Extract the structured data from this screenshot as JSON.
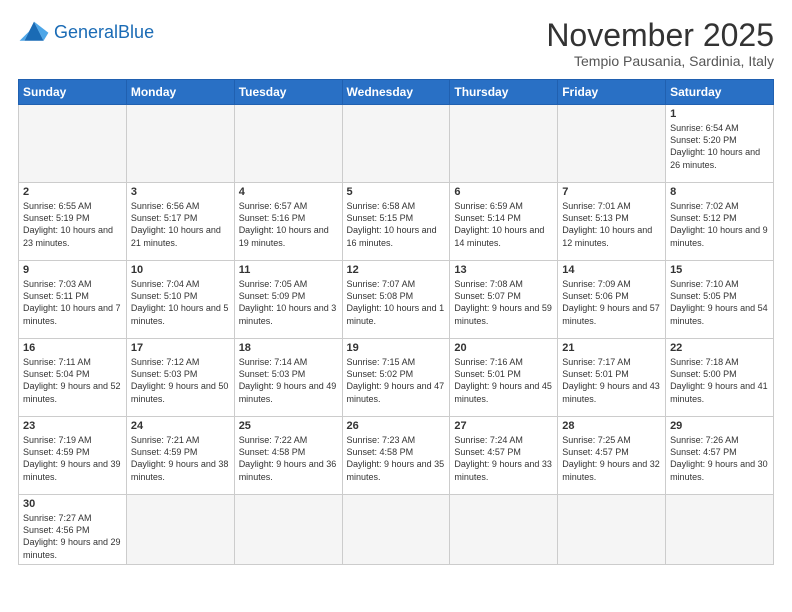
{
  "header": {
    "logo_general": "General",
    "logo_blue": "Blue",
    "month": "November 2025",
    "location": "Tempio Pausania, Sardinia, Italy"
  },
  "days_of_week": [
    "Sunday",
    "Monday",
    "Tuesday",
    "Wednesday",
    "Thursday",
    "Friday",
    "Saturday"
  ],
  "weeks": [
    [
      {
        "day": "",
        "empty": true
      },
      {
        "day": "",
        "empty": true
      },
      {
        "day": "",
        "empty": true
      },
      {
        "day": "",
        "empty": true
      },
      {
        "day": "",
        "empty": true
      },
      {
        "day": "",
        "empty": true
      },
      {
        "day": "1",
        "sunrise": "6:54 AM",
        "sunset": "5:20 PM",
        "daylight": "10 hours and 26 minutes."
      }
    ],
    [
      {
        "day": "2",
        "sunrise": "6:55 AM",
        "sunset": "5:19 PM",
        "daylight": "10 hours and 23 minutes."
      },
      {
        "day": "3",
        "sunrise": "6:56 AM",
        "sunset": "5:17 PM",
        "daylight": "10 hours and 21 minutes."
      },
      {
        "day": "4",
        "sunrise": "6:57 AM",
        "sunset": "5:16 PM",
        "daylight": "10 hours and 19 minutes."
      },
      {
        "day": "5",
        "sunrise": "6:58 AM",
        "sunset": "5:15 PM",
        "daylight": "10 hours and 16 minutes."
      },
      {
        "day": "6",
        "sunrise": "6:59 AM",
        "sunset": "5:14 PM",
        "daylight": "10 hours and 14 minutes."
      },
      {
        "day": "7",
        "sunrise": "7:01 AM",
        "sunset": "5:13 PM",
        "daylight": "10 hours and 12 minutes."
      },
      {
        "day": "8",
        "sunrise": "7:02 AM",
        "sunset": "5:12 PM",
        "daylight": "10 hours and 9 minutes."
      }
    ],
    [
      {
        "day": "9",
        "sunrise": "7:03 AM",
        "sunset": "5:11 PM",
        "daylight": "10 hours and 7 minutes."
      },
      {
        "day": "10",
        "sunrise": "7:04 AM",
        "sunset": "5:10 PM",
        "daylight": "10 hours and 5 minutes."
      },
      {
        "day": "11",
        "sunrise": "7:05 AM",
        "sunset": "5:09 PM",
        "daylight": "10 hours and 3 minutes."
      },
      {
        "day": "12",
        "sunrise": "7:07 AM",
        "sunset": "5:08 PM",
        "daylight": "10 hours and 1 minute."
      },
      {
        "day": "13",
        "sunrise": "7:08 AM",
        "sunset": "5:07 PM",
        "daylight": "9 hours and 59 minutes."
      },
      {
        "day": "14",
        "sunrise": "7:09 AM",
        "sunset": "5:06 PM",
        "daylight": "9 hours and 57 minutes."
      },
      {
        "day": "15",
        "sunrise": "7:10 AM",
        "sunset": "5:05 PM",
        "daylight": "9 hours and 54 minutes."
      }
    ],
    [
      {
        "day": "16",
        "sunrise": "7:11 AM",
        "sunset": "5:04 PM",
        "daylight": "9 hours and 52 minutes."
      },
      {
        "day": "17",
        "sunrise": "7:12 AM",
        "sunset": "5:03 PM",
        "daylight": "9 hours and 50 minutes."
      },
      {
        "day": "18",
        "sunrise": "7:14 AM",
        "sunset": "5:03 PM",
        "daylight": "9 hours and 49 minutes."
      },
      {
        "day": "19",
        "sunrise": "7:15 AM",
        "sunset": "5:02 PM",
        "daylight": "9 hours and 47 minutes."
      },
      {
        "day": "20",
        "sunrise": "7:16 AM",
        "sunset": "5:01 PM",
        "daylight": "9 hours and 45 minutes."
      },
      {
        "day": "21",
        "sunrise": "7:17 AM",
        "sunset": "5:01 PM",
        "daylight": "9 hours and 43 minutes."
      },
      {
        "day": "22",
        "sunrise": "7:18 AM",
        "sunset": "5:00 PM",
        "daylight": "9 hours and 41 minutes."
      }
    ],
    [
      {
        "day": "23",
        "sunrise": "7:19 AM",
        "sunset": "4:59 PM",
        "daylight": "9 hours and 39 minutes."
      },
      {
        "day": "24",
        "sunrise": "7:21 AM",
        "sunset": "4:59 PM",
        "daylight": "9 hours and 38 minutes."
      },
      {
        "day": "25",
        "sunrise": "7:22 AM",
        "sunset": "4:58 PM",
        "daylight": "9 hours and 36 minutes."
      },
      {
        "day": "26",
        "sunrise": "7:23 AM",
        "sunset": "4:58 PM",
        "daylight": "9 hours and 35 minutes."
      },
      {
        "day": "27",
        "sunrise": "7:24 AM",
        "sunset": "4:57 PM",
        "daylight": "9 hours and 33 minutes."
      },
      {
        "day": "28",
        "sunrise": "7:25 AM",
        "sunset": "4:57 PM",
        "daylight": "9 hours and 32 minutes."
      },
      {
        "day": "29",
        "sunrise": "7:26 AM",
        "sunset": "4:57 PM",
        "daylight": "9 hours and 30 minutes."
      }
    ],
    [
      {
        "day": "30",
        "sunrise": "7:27 AM",
        "sunset": "4:56 PM",
        "daylight": "9 hours and 29 minutes.",
        "last": true
      },
      {
        "day": "",
        "empty": true,
        "last": true
      },
      {
        "day": "",
        "empty": true,
        "last": true
      },
      {
        "day": "",
        "empty": true,
        "last": true
      },
      {
        "day": "",
        "empty": true,
        "last": true
      },
      {
        "day": "",
        "empty": true,
        "last": true
      },
      {
        "day": "",
        "empty": true,
        "last": true
      }
    ]
  ],
  "labels": {
    "sunrise": "Sunrise:",
    "sunset": "Sunset:",
    "daylight": "Daylight:"
  }
}
